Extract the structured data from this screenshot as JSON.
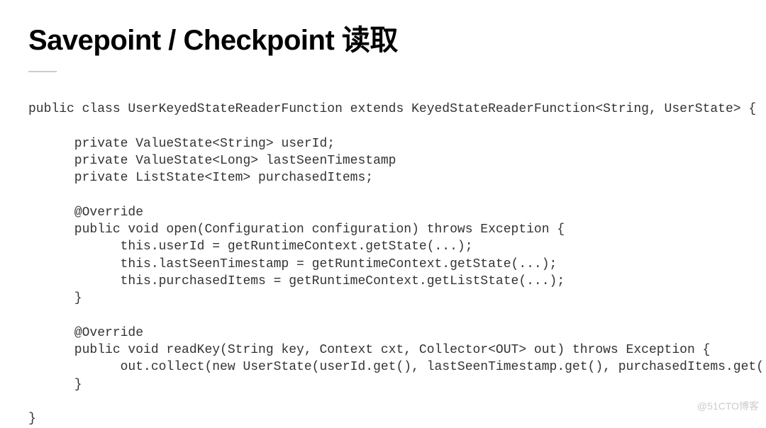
{
  "slide": {
    "title": "Savepoint / Checkpoint 读取",
    "code": "public class UserKeyedStateReaderFunction extends KeyedStateReaderFunction<String, UserState> {\n\n      private ValueState<String> userId;\n      private ValueState<Long> lastSeenTimestamp\n      private ListState<Item> purchasedItems;\n\n      @Override\n      public void open(Configuration configuration) throws Exception {\n            this.userId = getRuntimeContext.getState(...);\n            this.lastSeenTimestamp = getRuntimeContext.getState(...);\n            this.purchasedItems = getRuntimeContext.getListState(...);\n      }\n\n      @Override\n      public void readKey(String key, Context cxt, Collector<OUT> out) throws Exception {\n            out.collect(new UserState(userId.get(), lastSeenTimestamp.get(), purchasedItems.get()));\n      }\n\n}"
  },
  "watermark": "@51CTO博客"
}
